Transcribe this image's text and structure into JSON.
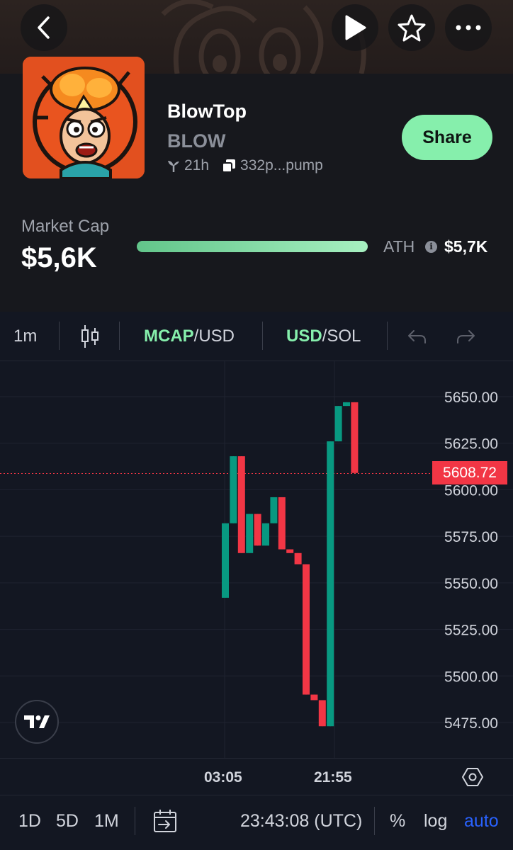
{
  "token": {
    "name": "BlowTop",
    "symbol": "BLOW",
    "age": "21h",
    "address": "332p...pump"
  },
  "header_buttons": {
    "back": "chevron-left-icon",
    "play": "play-icon",
    "favorite": "star-icon",
    "more": "more-icon"
  },
  "share_label": "Share",
  "market": {
    "cap_label": "Market Cap",
    "cap_value": "$5,6K",
    "ath_label": "ATH",
    "ath_value": "$5,7K",
    "ath_progress": 0.98
  },
  "toolbar": {
    "interval": "1m",
    "mcap_accent": "MCAP",
    "mcap_rest": "/USD",
    "usd_accent": "USD",
    "usd_rest": "/SOL"
  },
  "colors": {
    "accent": "#86efac",
    "up": "#089981",
    "down": "#f23645",
    "auto": "#2962ff"
  },
  "chart_data": {
    "type": "candlestick",
    "y_ticks": [
      "5650.00",
      "5625.00",
      "5600.00",
      "5575.00",
      "5550.00",
      "5525.00",
      "5500.00",
      "5475.00"
    ],
    "x_ticks": [
      "03:05",
      "21:55"
    ],
    "current_price": "5608.72",
    "ylim": [
      5466,
      5672
    ],
    "candles": [
      {
        "open": 5542,
        "close": 5582,
        "high": 5582,
        "low": 5542
      },
      {
        "open": 5582,
        "close": 5618,
        "high": 5618,
        "low": 5582
      },
      {
        "open": 5618,
        "close": 5566,
        "high": 5618,
        "low": 5566
      },
      {
        "open": 5566,
        "close": 5587,
        "high": 5587,
        "low": 5566
      },
      {
        "open": 5587,
        "close": 5570,
        "high": 5587,
        "low": 5570
      },
      {
        "open": 5570,
        "close": 5582,
        "high": 5582,
        "low": 5570
      },
      {
        "open": 5582,
        "close": 5596,
        "high": 5596,
        "low": 5582
      },
      {
        "open": 5596,
        "close": 5568,
        "high": 5596,
        "low": 5568
      },
      {
        "open": 5568,
        "close": 5566,
        "high": 5568,
        "low": 5566
      },
      {
        "open": 5566,
        "close": 5560,
        "high": 5566,
        "low": 5560
      },
      {
        "open": 5560,
        "close": 5490,
        "high": 5560,
        "low": 5490
      },
      {
        "open": 5490,
        "close": 5487,
        "high": 5490,
        "low": 5487
      },
      {
        "open": 5487,
        "close": 5473,
        "high": 5487,
        "low": 5473
      },
      {
        "open": 5473,
        "close": 5626,
        "high": 5626,
        "low": 5473
      },
      {
        "open": 5626,
        "close": 5645,
        "high": 5645,
        "low": 5626
      },
      {
        "open": 5645,
        "close": 5647,
        "high": 5647,
        "low": 5645
      },
      {
        "open": 5647,
        "close": 5609,
        "high": 5647,
        "low": 5609
      }
    ]
  },
  "bottom_bar": {
    "ranges": [
      "1D",
      "5D",
      "1M"
    ],
    "time": "23:43:08 (UTC)",
    "percent": "%",
    "log": "log",
    "auto": "auto"
  }
}
